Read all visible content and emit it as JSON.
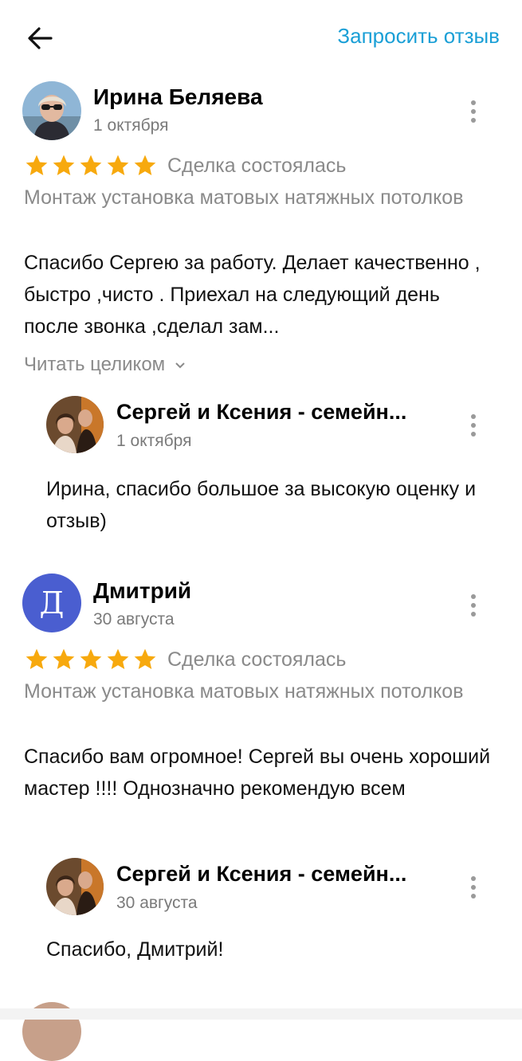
{
  "header": {
    "request_review_label": "Запросить отзыв"
  },
  "reviews": [
    {
      "author": "Ирина Беляева",
      "date": "1 октября",
      "rating": 5,
      "status": "Сделка состоялась",
      "service": "Монтаж установка матовых натяжных потолков",
      "text": "Спасибо Сергею за работу. Делает качественно , быстро ,чисто . Приехал на следующий день после звонка ,сделал зам...",
      "read_more": "Читать целиком",
      "reply": {
        "author": "Сергей и Ксения - семейн...",
        "date": "1 октября",
        "text": "Ирина, спасибо большое за  высокую оценку и отзыв)"
      }
    },
    {
      "author": "Дмитрий",
      "avatar_letter": "Д",
      "avatar_color": "#4a5ed0",
      "date": "30 августа",
      "rating": 5,
      "status": "Сделка состоялась",
      "service": "Монтаж установка матовых натяжных потолков",
      "text": "Спасибо вам огромное! Сергей вы очень хороший мастер !!!! Однозначно рекомендую всем",
      "reply": {
        "author": "Сергей и Ксения - семейн...",
        "date": "30 августа",
        "text": "Спасибо, Дмитрий!"
      }
    }
  ],
  "colors": {
    "accent": "#1a9fd6",
    "star": "#f7a90e",
    "muted_text": "#8a8a8a"
  }
}
